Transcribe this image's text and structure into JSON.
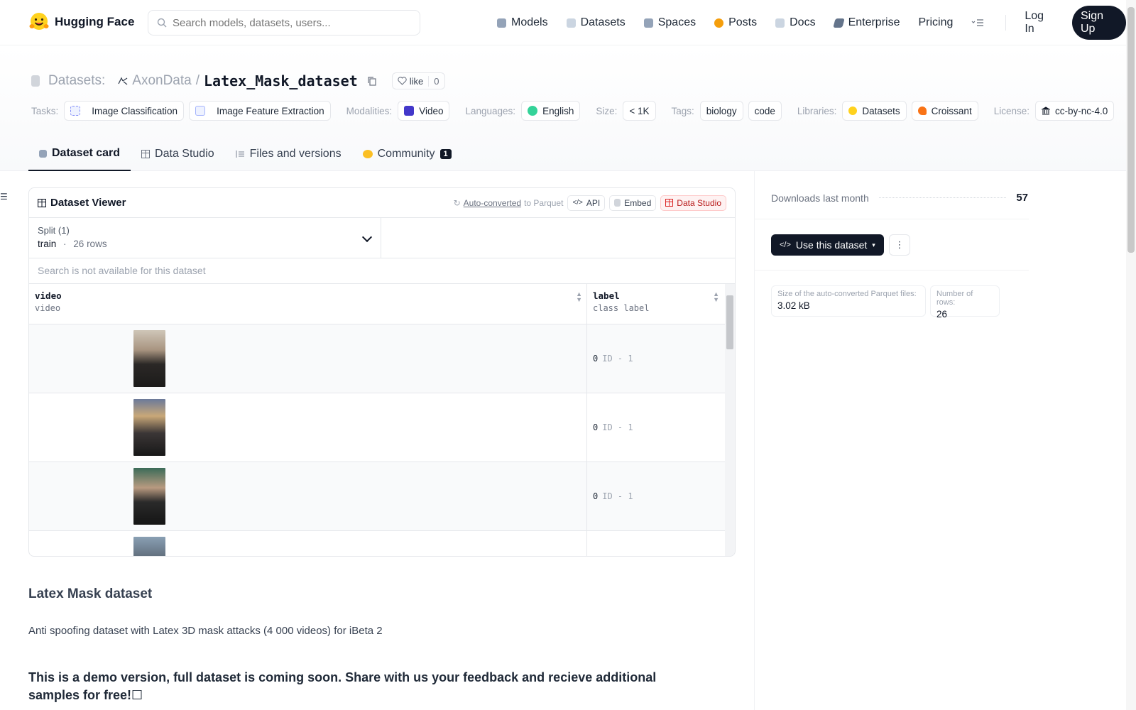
{
  "nav": {
    "brand": "Hugging Face",
    "search_placeholder": "Search models, datasets, users...",
    "items": [
      {
        "label": "Models",
        "icon": "models-icon",
        "color": "#94a3b8"
      },
      {
        "label": "Datasets",
        "icon": "datasets-icon",
        "color": "#cbd5e1"
      },
      {
        "label": "Spaces",
        "icon": "spaces-icon",
        "color": "#94a3b8"
      },
      {
        "label": "Posts",
        "icon": "posts-icon",
        "color": "#f59e0b"
      },
      {
        "label": "Docs",
        "icon": "docs-icon",
        "color": "#cbd5e1"
      },
      {
        "label": "Enterprise",
        "icon": "enterprise-icon",
        "color": "#64748b"
      },
      {
        "label": "Pricing"
      }
    ],
    "login": "Log In",
    "signup": "Sign Up"
  },
  "header": {
    "section": "Datasets:",
    "org": "AxonData",
    "sep": "/",
    "name": "Latex_Mask_dataset",
    "like_label": "like",
    "like_count": "0",
    "tags": {
      "tasks_label": "Tasks:",
      "tasks": [
        "Image Classification",
        "Image Feature Extraction"
      ],
      "modalities_label": "Modalities:",
      "modalities": [
        "Video"
      ],
      "languages_label": "Languages:",
      "languages": [
        "English"
      ],
      "size_label": "Size:",
      "size": "< 1K",
      "tags_label": "Tags:",
      "tags": [
        "biology",
        "code"
      ],
      "libraries_label": "Libraries:",
      "libraries": [
        "Datasets",
        "Croissant"
      ],
      "license_label": "License:",
      "license": "cc-by-nc-4.0"
    }
  },
  "tabs": [
    {
      "label": "Dataset card",
      "active": true
    },
    {
      "label": "Data Studio"
    },
    {
      "label": "Files and versions"
    },
    {
      "label": "Community",
      "badge": "1"
    }
  ],
  "viewer": {
    "title": "Dataset Viewer",
    "auto_converted": "Auto-converted",
    "to_parquet": "to Parquet",
    "api": "API",
    "embed": "Embed",
    "data_studio": "Data Studio",
    "split_label": "Split (1)",
    "split_value": "train",
    "split_dot": "·",
    "split_rows": "26 rows",
    "search_na": "Search is not available for this dataset",
    "columns": [
      {
        "name": "video",
        "type": "video"
      },
      {
        "name": "label",
        "type": "class label"
      }
    ],
    "rows": [
      {
        "label_value": "0",
        "label_name": "ID - 1",
        "thumb": "#3a3632"
      },
      {
        "label_value": "0",
        "label_name": "ID - 1",
        "thumb": "#4a4650"
      },
      {
        "label_value": "0",
        "label_name": "ID - 1",
        "thumb": "#2f4a3c"
      },
      {
        "label_value": "",
        "label_name": "",
        "thumb": "#5b6b78"
      }
    ]
  },
  "card": {
    "heading": "Latex Mask dataset",
    "intro": "Anti spoofing dataset with Latex 3D mask attacks (4 000 videos) for iBeta 2",
    "notice": "This is a demo version, full dataset is coming soon. Share with us your feedback and recieve additional samples for free!☐"
  },
  "sidebar": {
    "downloads_label": "Downloads last month",
    "downloads_value": "57",
    "use_dataset": "Use this dataset",
    "parquet_size_label": "Size of the auto-converted Parquet files:",
    "parquet_size_value": "3.02 kB",
    "rows_label": "Number of rows:",
    "rows_value": "26"
  }
}
